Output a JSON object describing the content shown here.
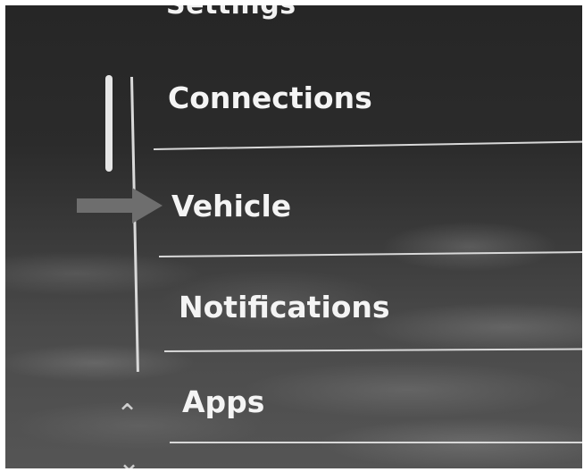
{
  "header": {
    "title": "Settings"
  },
  "menu": {
    "items": [
      {
        "label": "Connections"
      },
      {
        "label": "Vehicle"
      },
      {
        "label": "Notifications"
      },
      {
        "label": "Apps"
      }
    ]
  },
  "icons": {
    "pointer": "arrow-right-icon",
    "scroll_up": "chevron-up-icon",
    "scroll_down": "chevron-down-icon"
  },
  "colors": {
    "text": "#f4f4f4",
    "divider": "#d8d8d8",
    "arrow": "#6e6e6e"
  }
}
